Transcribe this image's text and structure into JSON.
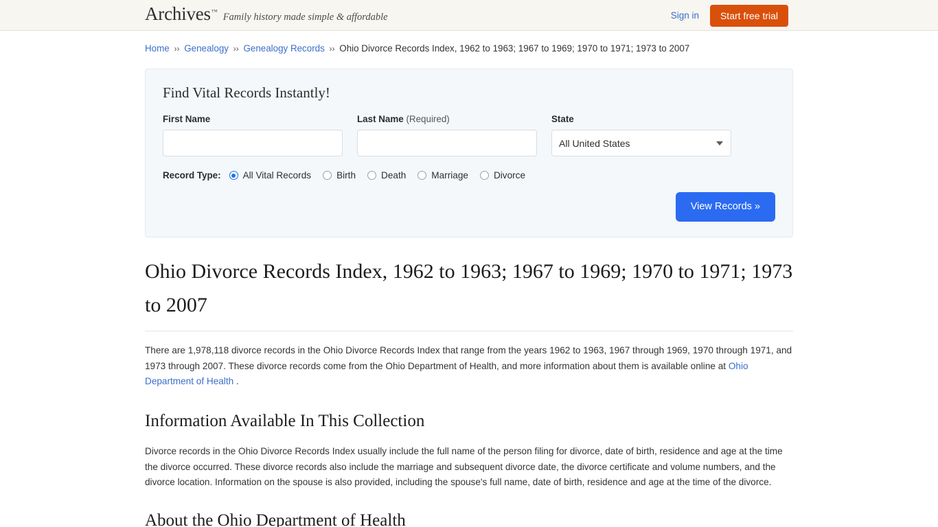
{
  "header": {
    "brand_name": "Archives",
    "brand_tm": "™",
    "tagline": "Family history made simple & affordable",
    "signin_label": "Sign in",
    "trial_label": "Start free trial",
    "trial_color": "#d9500b",
    "link_color": "#3b6ecc"
  },
  "breadcrumb": {
    "separator": "››",
    "items": [
      {
        "label": "Home",
        "link": true
      },
      {
        "label": "Genealogy",
        "link": true
      },
      {
        "label": "Genealogy Records",
        "link": true
      },
      {
        "label": "Ohio Divorce Records Index, 1962 to 1963; 1967 to 1969; 1970 to 1971; 1973 to 2007",
        "link": false
      }
    ]
  },
  "search_panel": {
    "title": "Find Vital Records Instantly!",
    "first_name": {
      "label": "First Name",
      "value": "",
      "placeholder": ""
    },
    "last_name": {
      "label": "Last Name",
      "required_note": "(Required)",
      "value": "",
      "placeholder": ""
    },
    "state": {
      "label": "State",
      "selected": "All United States"
    },
    "record_type": {
      "label": "Record Type:",
      "options": [
        {
          "label": "All Vital Records",
          "checked": true
        },
        {
          "label": "Birth",
          "checked": false
        },
        {
          "label": "Death",
          "checked": false
        },
        {
          "label": "Marriage",
          "checked": false
        },
        {
          "label": "Divorce",
          "checked": false
        }
      ]
    },
    "submit_label": "View Records »",
    "submit_color": "#2b6bf2"
  },
  "article": {
    "title": "Ohio Divorce Records Index, 1962 to 1963; 1967 to 1969; 1970 to 1971; 1973 to 2007",
    "intro_before_link": "There are 1,978,118 divorce records in the Ohio Divorce Records Index that range from the years 1962 to 1963, 1967 through 1969, 1970 through 1971, and 1973 through 2007. These divorce records come from the Ohio Department of Health, and more information about them is available online at ",
    "intro_link": "Ohio Department of Health",
    "intro_after_link": " .",
    "record_count": "1,978,118",
    "section_1": {
      "heading": "Information Available In This Collection",
      "paragraph": "Divorce records in the Ohio Divorce Records Index usually include the full name of the person filing for divorce, date of birth, residence and age at the time the divorce occurred. These divorce records also include the marriage and subsequent divorce date, the divorce certificate and volume numbers, and the divorce location. Information on the spouse is also provided, including the spouse's full name, date of birth, residence and age at the time of the divorce."
    },
    "section_2": {
      "heading": "About the Ohio Department of Health"
    }
  }
}
